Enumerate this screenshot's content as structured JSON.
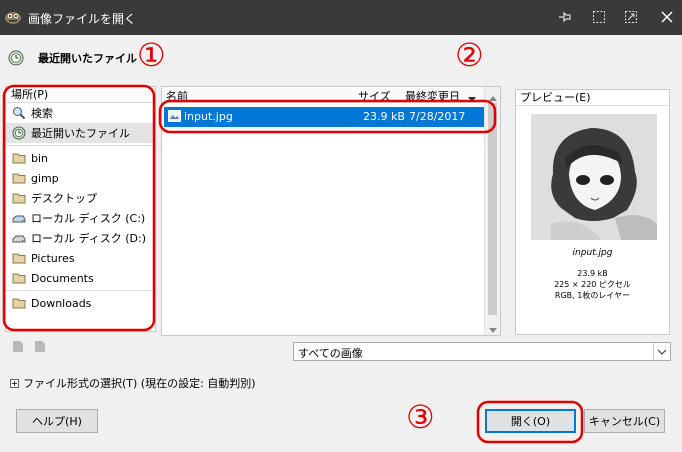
{
  "window": {
    "title": "画像ファイルを開く",
    "pin_icon": "pin-icon",
    "restore_icon": "restore-icon",
    "maximize_icon": "maximize-icon",
    "close_icon": "close-icon"
  },
  "location": {
    "label": "最近開いたファイル",
    "icon": "recent-icon"
  },
  "places": {
    "header": "場所(P)",
    "items": [
      {
        "label": "検索",
        "icon": "search-icon"
      },
      {
        "label": "最近開いたファイル",
        "icon": "recent-icon"
      },
      {
        "label": "bin",
        "icon": "folder-icon"
      },
      {
        "label": "gimp",
        "icon": "folder-icon"
      },
      {
        "label": "デスクトップ",
        "icon": "folder-icon"
      },
      {
        "label": "ローカル ディスク (C:)",
        "icon": "drive-icon"
      },
      {
        "label": "ローカル ディスク (D:)",
        "icon": "drive-icon"
      },
      {
        "label": "Pictures",
        "icon": "folder-icon"
      },
      {
        "label": "Documents",
        "icon": "folder-icon"
      },
      {
        "label": "Downloads",
        "icon": "folder-icon"
      }
    ]
  },
  "files": {
    "columns": {
      "name": "名前",
      "size": "サイズ",
      "modified": "最終変更日"
    },
    "rows": [
      {
        "name": "input.jpg",
        "size": "23.9 kB",
        "modified": "7/28/2017"
      }
    ]
  },
  "preview": {
    "header": "プレビュー(E)",
    "filename": "input.jpg",
    "size": "23.9 kB",
    "dimensions": "225 × 220 ピクセル",
    "mode": "RGB, 1枚のレイヤー"
  },
  "filter": {
    "value": "すべての画像"
  },
  "filetype": {
    "label": "ファイル形式の選択(T) (現在の設定: 自動判別)"
  },
  "buttons": {
    "help": "ヘルプ(H)",
    "open": "開く(O)",
    "cancel": "キャンセル(C)"
  },
  "annotations": {
    "one": "①",
    "two": "②",
    "three": "③"
  },
  "colors": {
    "titlebar": "#3a3a3a",
    "selection": "#0078d7",
    "annotation": "#e00000"
  }
}
